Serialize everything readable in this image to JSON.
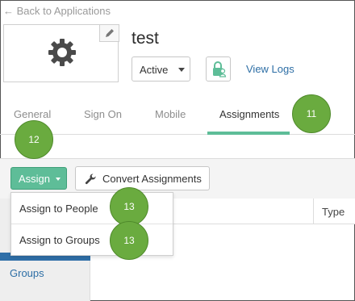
{
  "nav": {
    "back_label": "← Back to Applications"
  },
  "app": {
    "title": "test",
    "icon": "gear-icon",
    "status_selected": "Active",
    "view_logs_label": "View Logs"
  },
  "tabs": [
    {
      "label": "General",
      "active": false
    },
    {
      "label": "Sign On",
      "active": false
    },
    {
      "label": "Mobile",
      "active": false
    },
    {
      "label": "Assignments",
      "active": true
    }
  ],
  "toolbar": {
    "assign_label": "Assign",
    "convert_label": "Convert Assignments"
  },
  "dropdown": {
    "items": [
      {
        "label": "Assign to People"
      },
      {
        "label": "Assign to Groups"
      }
    ]
  },
  "table": {
    "columns": [
      "Type"
    ]
  },
  "side_panel": {
    "items": [
      {
        "label": "Groups"
      }
    ]
  },
  "callouts": [
    "11",
    "12",
    "13",
    "13"
  ],
  "colors": {
    "accent": "#5ebd98",
    "link": "#2d6ea5",
    "callout": "#6aab3f",
    "side_highlight": "#2f6fa8"
  }
}
